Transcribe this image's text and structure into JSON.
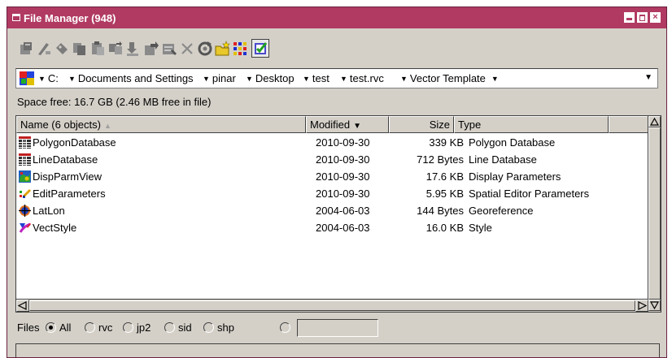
{
  "window": {
    "title": "File Manager (948)",
    "title_bar_color": "#b03a62",
    "close_glyph": "×"
  },
  "toolbar": {
    "buttons": [
      {
        "icon": "new-object-icon"
      },
      {
        "icon": "rename-icon"
      },
      {
        "icon": "tag-icon"
      },
      {
        "icon": "copy-icon"
      },
      {
        "icon": "paste-icon"
      },
      {
        "icon": "move-icon"
      },
      {
        "icon": "import-icon"
      },
      {
        "icon": "export-icon"
      },
      {
        "icon": "properties-icon"
      },
      {
        "icon": "delete-icon"
      },
      {
        "icon": "refresh-icon"
      },
      {
        "icon": "new-folder-icon"
      },
      {
        "icon": "grid-view-icon"
      },
      {
        "icon": "select-all-icon"
      }
    ]
  },
  "path": {
    "segments": [
      "C:",
      "Documents and Settings",
      "pinar",
      "Desktop",
      "test",
      "test.rvc",
      "Vector Template"
    ]
  },
  "space_free": "Space free: 16.7 GB  (2.46 MB free in file)",
  "columns": {
    "name": "Name  (6 objects)",
    "modified": "Modified",
    "size": "Size",
    "type": "Type"
  },
  "files": [
    {
      "name": "PolygonDatabase",
      "modified": "2010-09-30",
      "size": "339 KB",
      "type": "Polygon Database",
      "icon": "polygon-database-icon"
    },
    {
      "name": "LineDatabase",
      "modified": "2010-09-30",
      "size": "712 Bytes",
      "type": "Line Database",
      "icon": "line-database-icon"
    },
    {
      "name": "DispParmView",
      "modified": "2010-09-30",
      "size": "17.6 KB",
      "type": "Display Parameters",
      "icon": "display-parameters-icon"
    },
    {
      "name": "EditParameters",
      "modified": "2010-09-30",
      "size": "5.95 KB",
      "type": "Spatial Editor Parameters",
      "icon": "editor-parameters-icon"
    },
    {
      "name": "LatLon",
      "modified": "2004-06-03",
      "size": "144 Bytes",
      "type": "Georeference",
      "icon": "georeference-icon"
    },
    {
      "name": "VectStyle",
      "modified": "2004-06-03",
      "size": "16.0 KB",
      "type": "Style",
      "icon": "style-icon"
    }
  ],
  "filter": {
    "label": "Files",
    "options": [
      "All",
      "rvc",
      "jp2",
      "sid",
      "shp"
    ],
    "selected": "All",
    "custom_value": ""
  }
}
